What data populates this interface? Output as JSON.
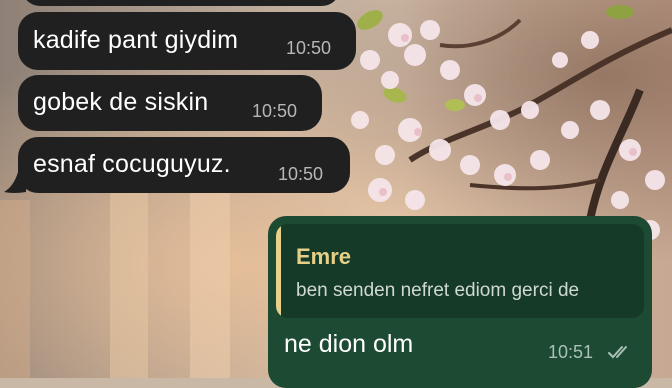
{
  "chat": {
    "incoming_messages": [
      {
        "text": "kadife pant giydim",
        "time": "10:50"
      },
      {
        "text": "gobek de siskin",
        "time": "10:50"
      },
      {
        "text": "esnaf cocuguyuz.",
        "time": "10:50"
      }
    ],
    "outgoing_message": {
      "reply_to": {
        "sender": "Emre",
        "text": "ben senden nefret ediom gerci de"
      },
      "text": "ne dion olm",
      "time": "10:51",
      "status_icon": "double-check-icon"
    }
  },
  "colors": {
    "incoming_bubble": "#202020",
    "outgoing_bubble": "#1c4a33",
    "reply_accent": "#e8d28a"
  }
}
